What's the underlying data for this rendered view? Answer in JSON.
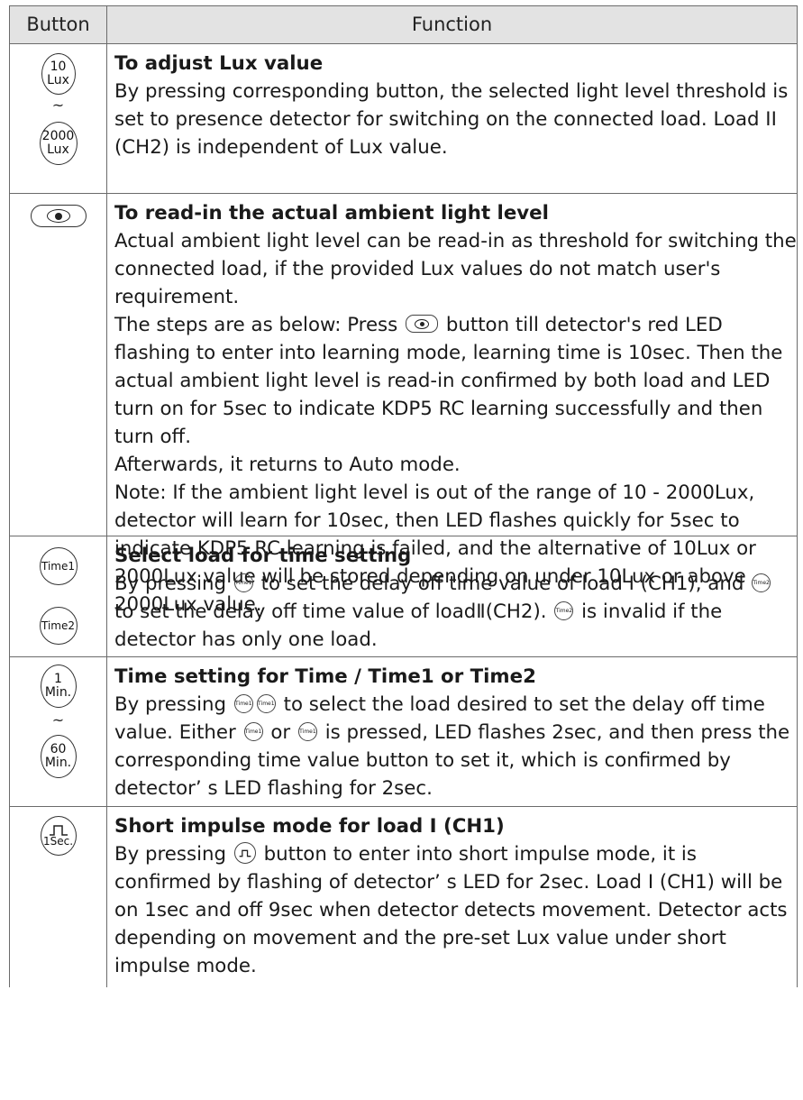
{
  "header": {
    "button": "Button",
    "function": "Function"
  },
  "rows": [
    {
      "title": "To adjust Lux value",
      "body": "By pressing corresponding button, the selected light level threshold is set to presence detector for switching on the connected load. Load II (CH2) is independent of Lux value.",
      "btn_top": [
        "10",
        "Lux"
      ],
      "btn_bottom": [
        "2000",
        "Lux"
      ],
      "tilde": "~"
    },
    {
      "title": "To read-in the actual ambient light level",
      "p1": "Actual ambient light level can be read-in as threshold for switching the connected load, if the provided Lux values do not match user's requirement.",
      "p2a": "The steps are as below: Press",
      "p2b": "button till detector's red LED flashing to enter into learning mode, learning time is 10sec. Then the actual ambient light level is read-in confirmed by both load and LED turn on for 5sec to indicate KDP5 RC learning successfully and then turn off.",
      "p3": "Afterwards, it returns to Auto mode.",
      "p4": "Note: If the ambient light level is out of the range of 10 - 2000Lux, detector will learn for 10sec, then LED flashes quickly for 5sec to indicate KDP5 RC learning is failed, and the alternative of 10Lux or 2000Lux value will be stored depending on under 10Lux or above 2000Lux value."
    },
    {
      "title": "Select load for time setting",
      "a": "By pressing",
      "b": "to set the delay off time value of load I (CH1), and",
      "c": "to set the delay off time value of loadⅡ(CH2).",
      "d": "is invalid if the detector has only one load.",
      "btn_top": "Time1",
      "btn_bottom": "Time2",
      "icon1": "Time1",
      "icon2": "Time2"
    },
    {
      "title": "Time setting for Time / Time1 or Time2",
      "a": "By pressing",
      "b": "to select the load desired to set the delay off time value. Either",
      "c": "or",
      "d": "is pressed, LED flashes 2sec, and then press the corresponding time value button to set it, which is confirmed by detector’ s LED flashing for 2sec.",
      "btn_top": [
        "1",
        "Min."
      ],
      "btn_bottom": [
        "60",
        "Min."
      ],
      "tilde": "~",
      "icon": "Time1"
    },
    {
      "title": "Short impulse mode for load I (CH1)",
      "a": "By pressing",
      "b": "button to enter into short impulse mode, it is confirmed by flashing of detector’ s LED for 2sec. Load I (CH1) will be on 1sec and off 9sec when detector detects movement. Detector acts depending on movement and the pre-set Lux value under short impulse mode.",
      "btn_label": "1Sec."
    }
  ]
}
